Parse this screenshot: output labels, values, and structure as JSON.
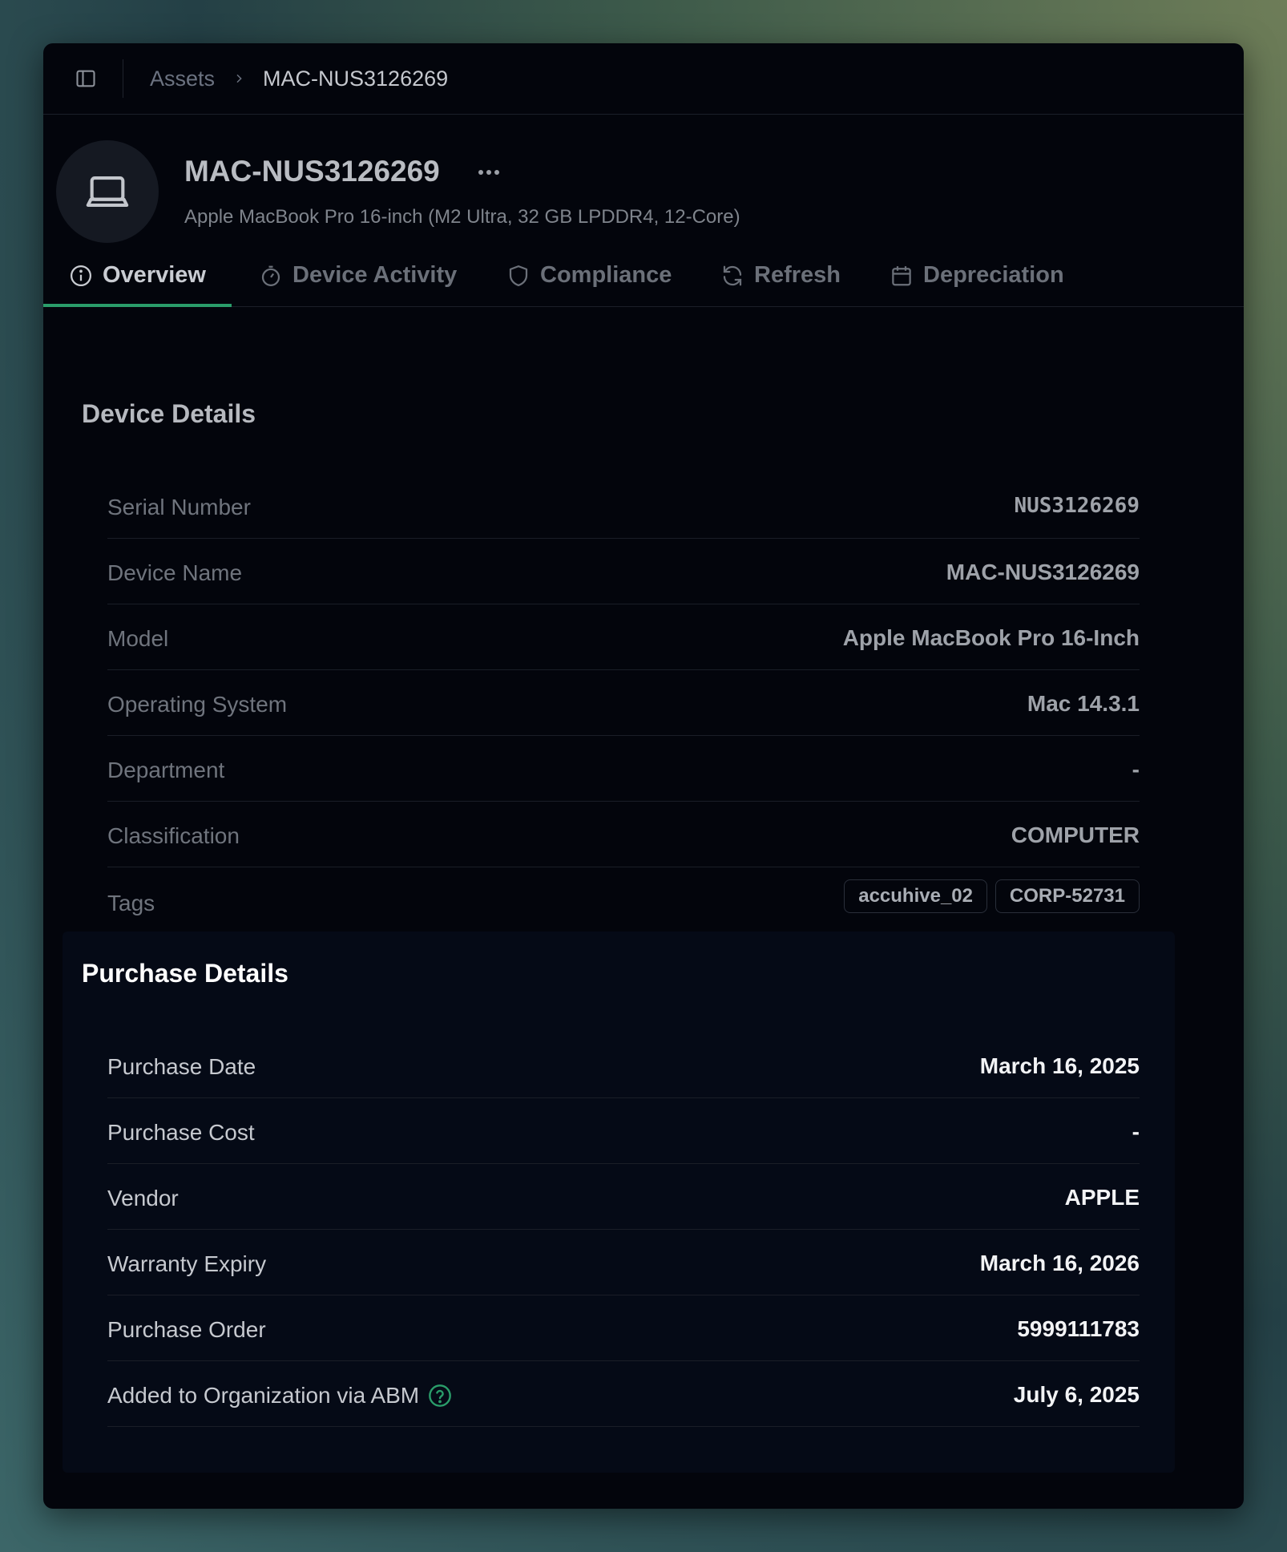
{
  "breadcrumb": {
    "parent": "Assets",
    "current": "MAC-NUS3126269"
  },
  "header": {
    "title": "MAC-NUS3126269",
    "subtitle": "Apple MacBook Pro 16-inch (M2 Ultra, 32 GB LPDDR4, 12-Core)"
  },
  "tabs": [
    {
      "label": "Overview",
      "icon": "info-icon",
      "active": true
    },
    {
      "label": "Device Activity",
      "icon": "timer-icon"
    },
    {
      "label": "Compliance",
      "icon": "shield-icon"
    },
    {
      "label": "Refresh",
      "icon": "refresh-icon"
    },
    {
      "label": "Depreciation",
      "icon": "calendar-icon"
    }
  ],
  "device_details": {
    "title": "Device Details",
    "rows": [
      {
        "label": "Serial Number",
        "value": "NUS3126269"
      },
      {
        "label": "Device Name",
        "value": "MAC-NUS3126269"
      },
      {
        "label": "Model",
        "value": "Apple MacBook Pro 16-Inch"
      },
      {
        "label": "Operating System",
        "value": "Mac 14.3.1"
      },
      {
        "label": "Department",
        "value": "-"
      },
      {
        "label": "Classification",
        "value": "COMPUTER"
      },
      {
        "label": "Tags",
        "value": ""
      }
    ],
    "tags": [
      "accuhive_02",
      "CORP-52731"
    ]
  },
  "purchase_details": {
    "title": "Purchase Details",
    "rows": [
      {
        "label": "Purchase Date",
        "value": "March 16, 2025"
      },
      {
        "label": "Purchase Cost",
        "value": "-"
      },
      {
        "label": "Vendor",
        "value": "APPLE"
      },
      {
        "label": "Warranty Expiry",
        "value": "March 16, 2026"
      },
      {
        "label": "Purchase Order",
        "value": "5999111783"
      },
      {
        "label": "Added to Organization via ABM",
        "value": "July 6, 2025",
        "help_icon": "help-circle-icon"
      }
    ]
  },
  "colors": {
    "accent": "#2a9d6a",
    "window_bg": "#03050c",
    "card_bg": "#050a16"
  }
}
